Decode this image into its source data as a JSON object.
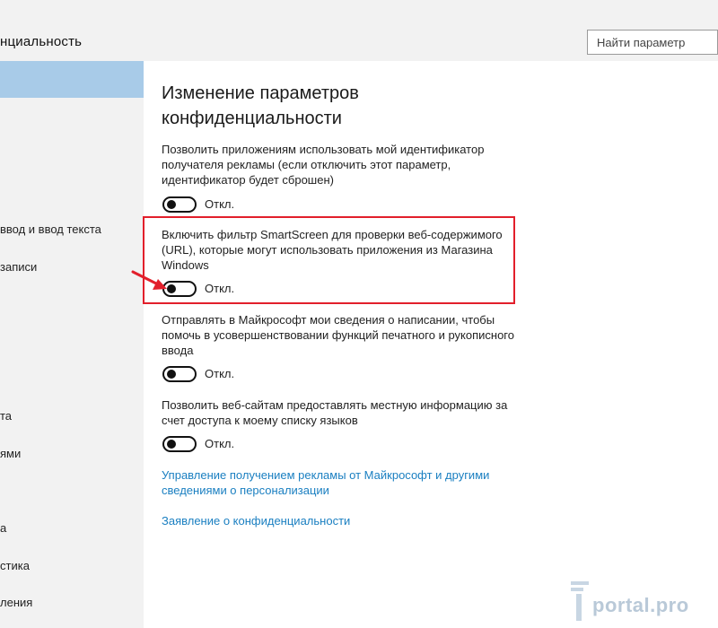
{
  "header": {
    "title": "нциальность",
    "search_placeholder": "Найти параметр"
  },
  "sidebar": {
    "items": [
      {
        "label": "ввод и ввод текста"
      },
      {
        "label": "записи"
      },
      {
        "label": "та"
      },
      {
        "label": "ями"
      },
      {
        "label": "а"
      },
      {
        "label": "стика"
      },
      {
        "label": "ления"
      }
    ]
  },
  "main": {
    "title": "Изменение параметров конфиденциальности",
    "settings": [
      {
        "description": "Позволить приложениям использовать мой идентификатор получателя рекламы (если отключить этот параметр, идентификатор будет сброшен)",
        "state_label": "Откл.",
        "on": false
      },
      {
        "description": "Включить фильтр SmartScreen для проверки веб-содержимого (URL), которые могут использовать приложения из Магазина Windows",
        "state_label": "Откл.",
        "on": false
      },
      {
        "description": "Отправлять в Майкрософт мои сведения о написании, чтобы помочь в усовершенствовании функций печатного и рукописного ввода",
        "state_label": "Откл.",
        "on": false
      },
      {
        "description": "Позволить веб-сайтам предоставлять местную информацию за счет доступа к моему списку языков",
        "state_label": "Откл.",
        "on": false
      }
    ],
    "links": [
      {
        "label": "Управление получением рекламы от Майкрософт и другими сведениями о персонализации"
      },
      {
        "label": "Заявление о конфиденциальности"
      }
    ]
  },
  "watermark": {
    "text": "portal.pro"
  },
  "colors": {
    "accent_link": "#1a7fc1",
    "highlight": "#e21f2b",
    "selected": "#a8cbe8"
  }
}
